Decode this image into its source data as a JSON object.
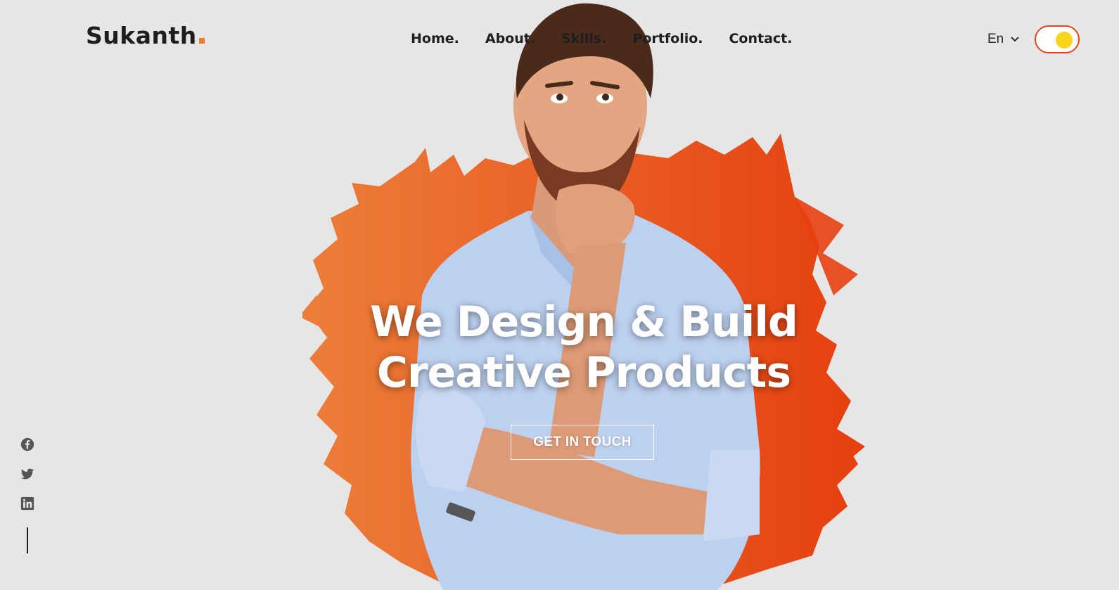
{
  "brand": {
    "name": "Sukanth",
    "accent": "#ec7a2c"
  },
  "nav": {
    "items": [
      {
        "label": "Home."
      },
      {
        "label": "About."
      },
      {
        "label": "Skills."
      },
      {
        "label": "Portfolio."
      },
      {
        "label": "Contact."
      }
    ]
  },
  "language": {
    "selected": "En",
    "icon": "chevron-down-icon"
  },
  "theme_toggle": {
    "state": "on",
    "border_color": "#e2451c",
    "knob_color": "#f6d51c"
  },
  "hero": {
    "title_line1": "We Design & Build",
    "title_line2": "Creative Products",
    "cta_label": "GET IN TOUCH",
    "splash_colors": [
      "#ec7a2c",
      "#e2451c"
    ]
  },
  "social": {
    "icons": [
      "facebook-icon",
      "twitter-icon",
      "linkedin-icon"
    ]
  },
  "colors": {
    "background": "#e6e6e6",
    "text": "#1e1e1e"
  }
}
